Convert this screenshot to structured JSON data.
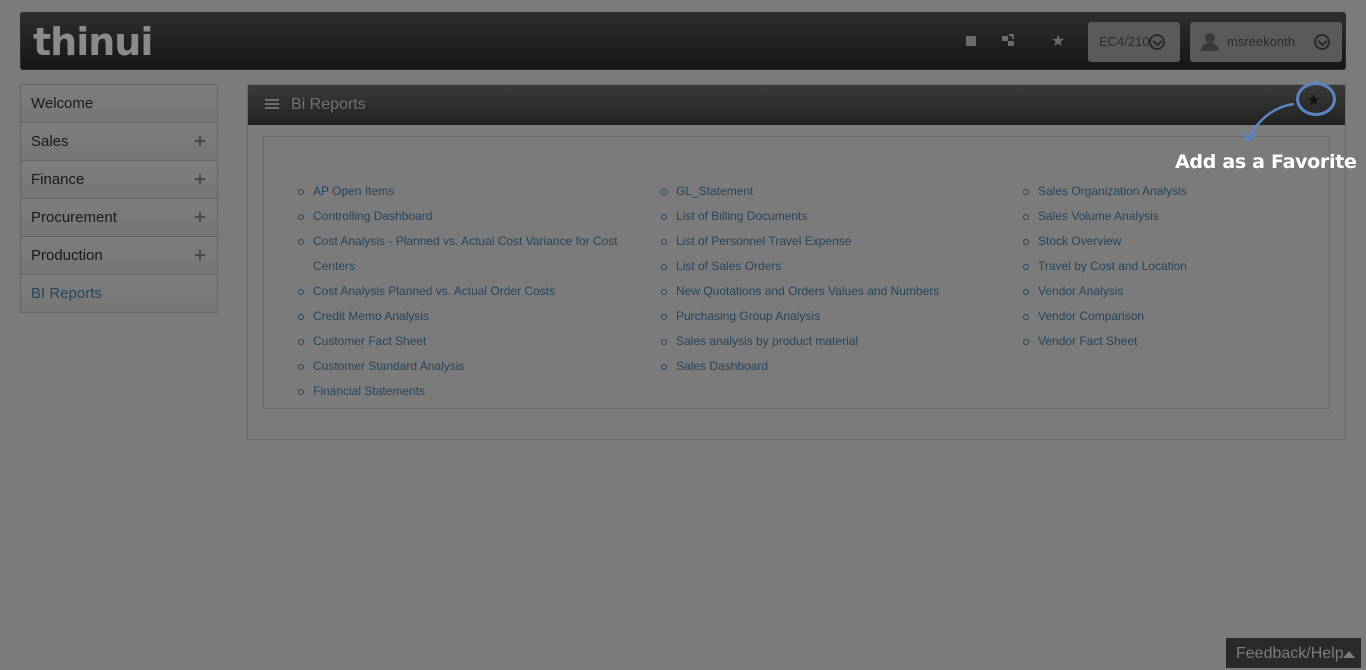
{
  "header": {
    "logo": "thinui",
    "icons": [
      "document-icon",
      "share-icon",
      "star-icon"
    ],
    "system": "EC4/210",
    "user": "msreekonth"
  },
  "sidebar": {
    "items": [
      {
        "label": "Welcome",
        "expandable": false
      },
      {
        "label": "Sales",
        "expandable": true
      },
      {
        "label": "Finance",
        "expandable": true
      },
      {
        "label": "Procurement",
        "expandable": true
      },
      {
        "label": "Production",
        "expandable": true
      },
      {
        "label": "BI Reports",
        "expandable": false,
        "active": true
      }
    ]
  },
  "panel": {
    "title": "Bi Reports",
    "columns": [
      [
        "AP Open Items",
        "Controlling Dashboard",
        "Cost Analysis - Planned vs. Actual Cost Variance for Cost Centers",
        "Cost Analysis Planned vs. Actual Order Costs",
        "Credit Memo Analysis",
        "Customer Fact Sheet",
        "Customer Standard Analysis",
        "Financial Statements"
      ],
      [
        "GL_Statement",
        "List of Billing Documents",
        "List of Personnel Travel Expense",
        "List of Sales Orders",
        "New Quotations and Orders Values and Numbers",
        "Purchasing Group Analysis",
        "Sales analysis by product material",
        "Sales Dashboard"
      ],
      [
        "Sales Organization Analysis",
        "Sales Volume Analysis",
        "Stock Overview",
        "Travel by Cost and Location",
        "Vendor Analysis",
        "Vendor Comparison",
        "Vendor Fact Sheet"
      ]
    ]
  },
  "annotation": {
    "text": "Add as a Favorite"
  },
  "feedback": {
    "label": "Feedback/Help"
  },
  "colors": {
    "overlay_bg": "#7b7b7b",
    "link": "#25465e",
    "annotation_ring": "#5a87c4"
  }
}
